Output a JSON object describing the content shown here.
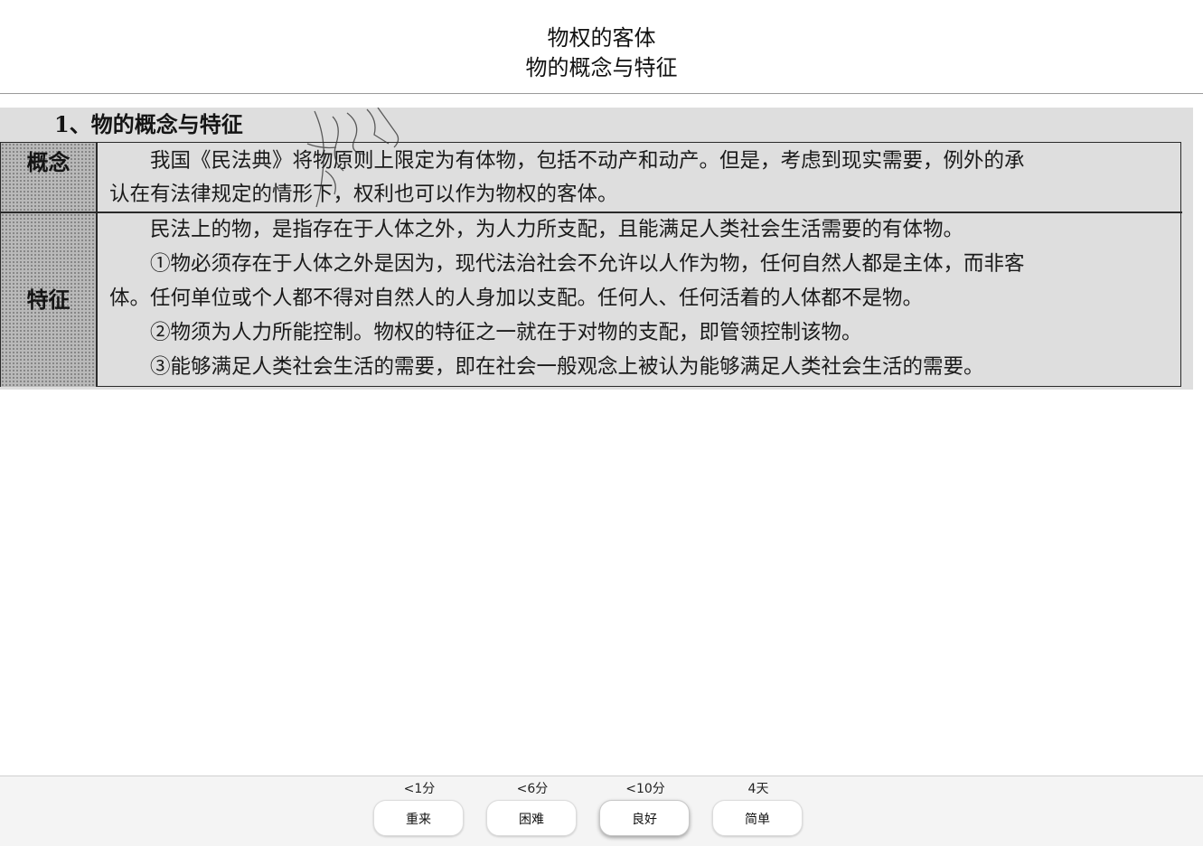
{
  "header": {
    "title": "物权的客体",
    "subtitle": "物的概念与特征"
  },
  "figure": {
    "heading": "1、物的概念与特征",
    "rows": [
      {
        "label": "概念",
        "lines": [
          "　　我国《民法典》将物原则上限定为有体物，包括不动产和动产。但是，考虑到现实需要，例外的承",
          "认在有法律规定的情形下，权利也可以作为物权的客体。"
        ]
      },
      {
        "label": "特征",
        "lines": [
          "　　民法上的物，是指存在于人体之外，为人力所支配，且能满足人类社会生活需要的有体物。",
          "　　①物必须存在于人体之外是因为，现代法治社会不允许以人作为物，任何自然人都是主体，而非客",
          "体。任何单位或个人都不得对自然人的人身加以支配。任何人、任何活着的人体都不是物。",
          "　　②物须为人力所能控制。物权的特征之一就在于对物的支配，即管领控制该物。",
          "　　③能够满足人类社会生活的需要，即在社会一般观念上被认为能够满足人类社会生活的需要。"
        ]
      }
    ]
  },
  "answers": [
    {
      "interval": "<1分",
      "label": "重来"
    },
    {
      "interval": "<6分",
      "label": "困难"
    },
    {
      "interval": "<10分",
      "label": "良好"
    },
    {
      "interval": "4天",
      "label": "简单"
    }
  ]
}
